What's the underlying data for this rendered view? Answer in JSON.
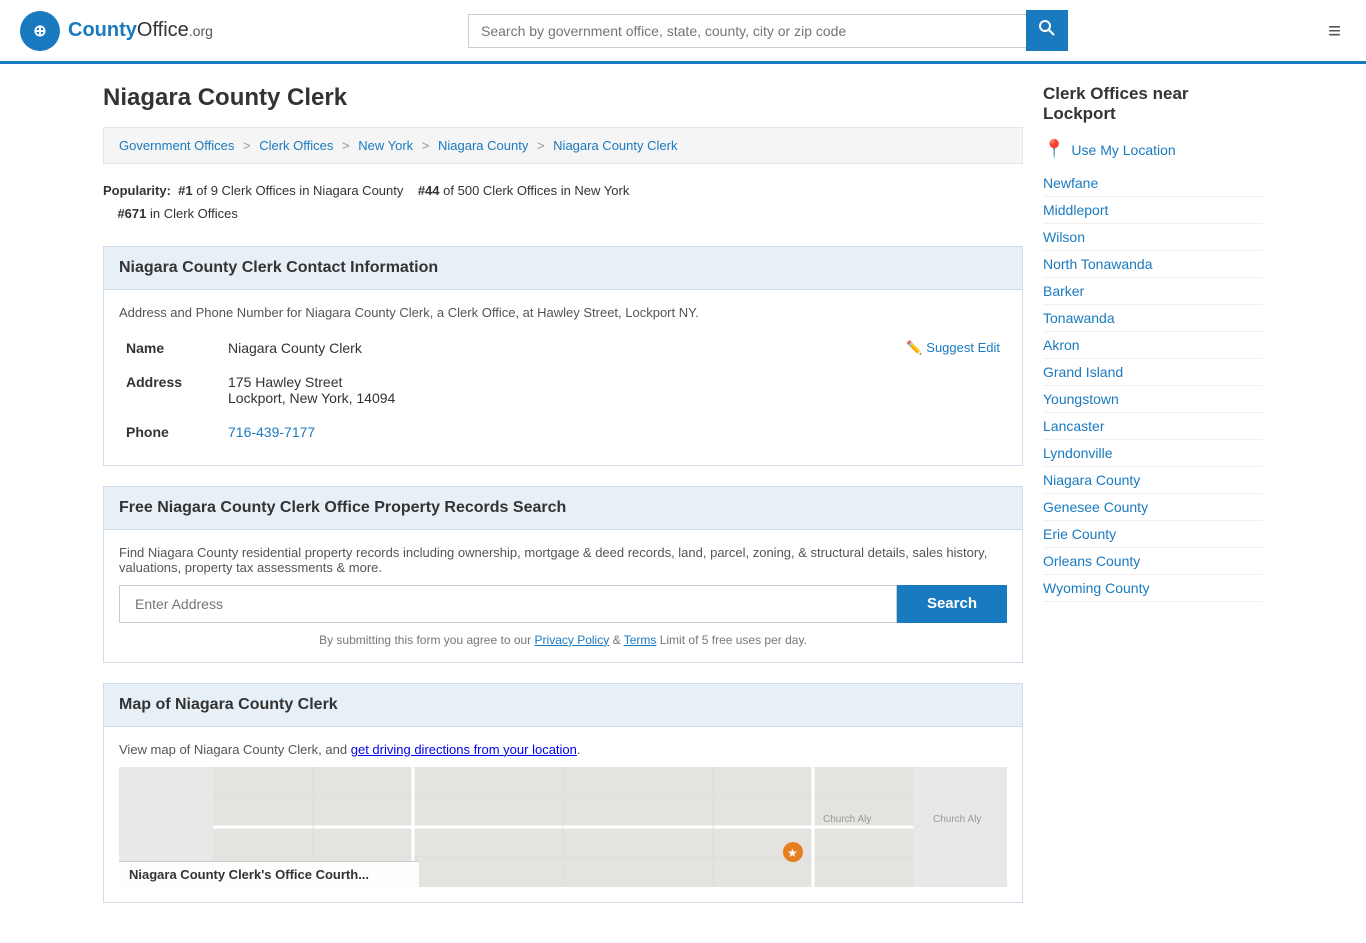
{
  "header": {
    "logo_text": "County",
    "logo_org": "Office",
    "logo_tld": ".org",
    "search_placeholder": "Search by government office, state, county, city or zip code",
    "search_icon": "🔍",
    "menu_icon": "≡"
  },
  "page": {
    "title": "Niagara County Clerk"
  },
  "breadcrumb": {
    "items": [
      {
        "label": "Government Offices",
        "href": "#"
      },
      {
        "label": "Clerk Offices",
        "href": "#"
      },
      {
        "label": "New York",
        "href": "#"
      },
      {
        "label": "Niagara County",
        "href": "#"
      },
      {
        "label": "Niagara County Clerk",
        "href": "#"
      }
    ]
  },
  "popularity": {
    "rank_county": "#1",
    "total_county": "9",
    "rank_state": "#44",
    "total_state": "500",
    "rank_all": "#671",
    "label_county": "of 9 Clerk Offices in Niagara County",
    "label_state": "of 500 Clerk Offices in New York",
    "label_all": "in Clerk Offices"
  },
  "contact_section": {
    "title": "Niagara County Clerk Contact Information",
    "description": "Address and Phone Number for Niagara County Clerk, a Clerk Office, at Hawley Street, Lockport NY.",
    "name_label": "Name",
    "name_value": "Niagara County Clerk",
    "address_label": "Address",
    "address_line1": "175 Hawley Street",
    "address_line2": "Lockport, New York, 14094",
    "phone_label": "Phone",
    "phone_value": "716-439-7177",
    "suggest_edit": "Suggest Edit"
  },
  "property_section": {
    "title": "Free Niagara County Clerk Office Property Records Search",
    "description": "Find Niagara County residential property records including ownership, mortgage & deed records, land, parcel, zoning, & structural details, sales history, valuations, property tax assessments & more.",
    "input_placeholder": "Enter Address",
    "search_button": "Search",
    "disclaimer": "By submitting this form you agree to our",
    "privacy_policy": "Privacy Policy",
    "and": "&",
    "terms": "Terms",
    "limit": "Limit of 5 free uses per day."
  },
  "map_section": {
    "title": "Map of Niagara County Clerk",
    "description": "View map of Niagara County Clerk, and",
    "directions_link": "get driving directions from your location",
    "map_label": "Niagara County Clerk's Office Courth..."
  },
  "sidebar": {
    "title": "Clerk Offices near Lockport",
    "use_my_location": "Use My Location",
    "links": [
      {
        "label": "Newfane"
      },
      {
        "label": "Middleport"
      },
      {
        "label": "Wilson"
      },
      {
        "label": "North Tonawanda"
      },
      {
        "label": "Barker"
      },
      {
        "label": "Tonawanda"
      },
      {
        "label": "Akron"
      },
      {
        "label": "Grand Island"
      },
      {
        "label": "Youngstown"
      },
      {
        "label": "Lancaster"
      },
      {
        "label": "Lyndonville"
      },
      {
        "label": "Niagara County"
      },
      {
        "label": "Genesee County"
      },
      {
        "label": "Erie County"
      },
      {
        "label": "Orleans County"
      },
      {
        "label": "Wyoming County"
      }
    ]
  }
}
